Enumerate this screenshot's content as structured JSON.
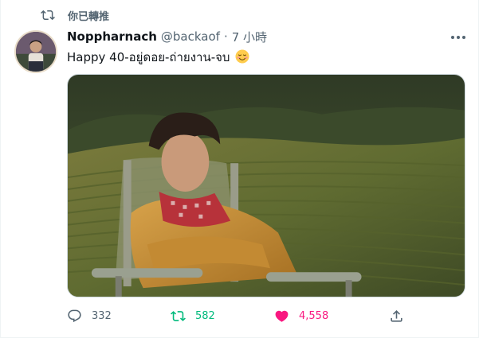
{
  "retweet_banner": {
    "text": "你已轉推",
    "icon": "retweet-icon"
  },
  "tweet": {
    "author_name": "Noppharnach",
    "handle": "@backaof",
    "separator": "·",
    "time": "7 小時",
    "text": "Happy 40-อยู่ดอย-ถ่ายงาน-จบ",
    "emoji": "smiling-face-with-closed-eyes-emoji"
  },
  "actions": {
    "reply": {
      "icon": "reply-icon",
      "count": "332"
    },
    "retweet": {
      "icon": "retweet-icon",
      "count": "582",
      "active": true
    },
    "like": {
      "icon": "heart-icon",
      "count": "4,558",
      "active": true
    },
    "share": {
      "icon": "share-icon"
    }
  },
  "colors": {
    "muted": "#536471",
    "retweet_active": "#00ba7c",
    "like_active": "#f91880",
    "text": "#0f1419"
  }
}
